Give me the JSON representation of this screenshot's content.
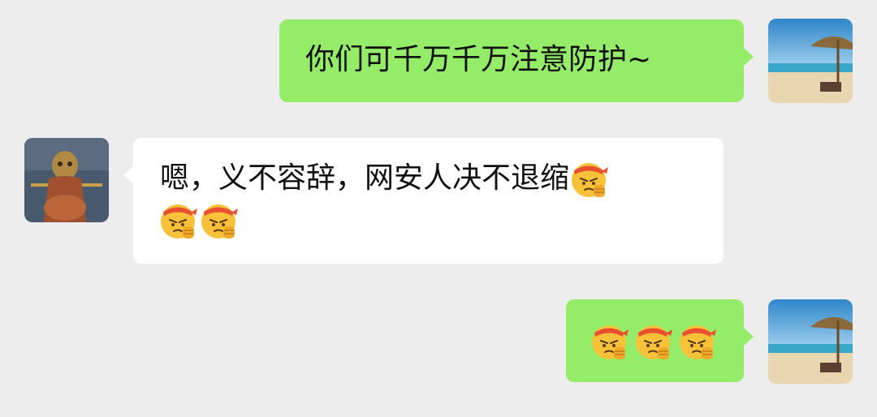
{
  "chat": {
    "messages": [
      {
        "id": "m1",
        "side": "sent",
        "text": "你们可千万千万注意防护~",
        "avatar": "beach-umbrella-avatar"
      },
      {
        "id": "m2",
        "side": "received",
        "text_line1": "嗯，义不容辞，网安人决不退缩",
        "emoji_inline": "determined-emoji",
        "emoji_line2": [
          "determined-emoji",
          "determined-emoji"
        ],
        "avatar": "monkey-king-figurine-avatar"
      },
      {
        "id": "m3",
        "side": "sent",
        "emojis": [
          "determined-emoji",
          "determined-emoji",
          "determined-emoji"
        ],
        "avatar": "beach-umbrella-avatar"
      }
    ]
  },
  "colors": {
    "background": "#ededed",
    "sent_bubble": "#95ec69",
    "received_bubble": "#ffffff",
    "text": "#111111"
  }
}
